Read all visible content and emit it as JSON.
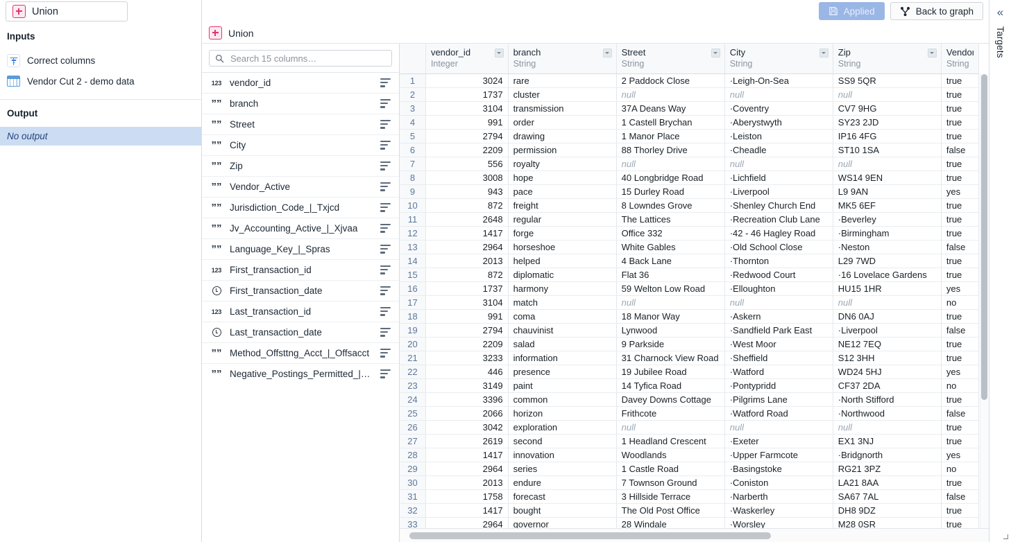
{
  "node": {
    "title": "Union",
    "icon": "union-icon"
  },
  "sidebar": {
    "inputs_title": "Inputs",
    "inputs": [
      {
        "label": "Correct columns",
        "icon": "filter-step-icon"
      },
      {
        "label": "Vendor Cut 2 - demo data",
        "icon": "table-dataset-icon"
      }
    ],
    "output_title": "Output",
    "output_value": "No output"
  },
  "toolbar": {
    "applied_label": "Applied",
    "applied_icon": "save-icon",
    "back_label": "Back to graph",
    "back_icon": "graph-icon"
  },
  "rail": {
    "collapse_icon": "chevron-double-left-icon",
    "label": "Targets"
  },
  "panel": {
    "title": "Union"
  },
  "search": {
    "placeholder": "Search 15 columns…",
    "value": "",
    "icon": "search-icon"
  },
  "columns_panel": {
    "items": [
      {
        "name": "vendor_id",
        "type": "number"
      },
      {
        "name": "branch",
        "type": "string"
      },
      {
        "name": "Street",
        "type": "string"
      },
      {
        "name": "City",
        "type": "string"
      },
      {
        "name": "Zip",
        "type": "string"
      },
      {
        "name": "Vendor_Active",
        "type": "string"
      },
      {
        "name": "Jurisdiction_Code_|_Txjcd",
        "type": "string"
      },
      {
        "name": "Jv_Accounting_Active_|_Xjvaa",
        "type": "string"
      },
      {
        "name": "Language_Key_|_Spras",
        "type": "string"
      },
      {
        "name": "First_transaction_id",
        "type": "number"
      },
      {
        "name": "First_transaction_date",
        "type": "date"
      },
      {
        "name": "Last_transaction_id",
        "type": "number"
      },
      {
        "name": "Last_transaction_date",
        "type": "date"
      },
      {
        "name": "Method_Offsttng_Acct_|_Offsacct",
        "type": "string"
      },
      {
        "name": "Negative_Postings_Permitted_|…",
        "type": "string"
      }
    ]
  },
  "table": {
    "headers": [
      {
        "name": "vendor_id",
        "type": "Integer",
        "caret": true
      },
      {
        "name": "branch",
        "type": "String",
        "caret": true
      },
      {
        "name": "Street",
        "type": "String",
        "caret": true
      },
      {
        "name": "City",
        "type": "String",
        "caret": true
      },
      {
        "name": "Zip",
        "type": "String",
        "caret": true
      },
      {
        "name": "Vendor_",
        "type": "String",
        "caret": false
      }
    ],
    "rows": [
      {
        "n": "1",
        "vendor_id": "3024",
        "branch": "rare",
        "street": "2 Paddock Close",
        "city": "·Leigh-On-Sea",
        "zip": "SS9 5QR",
        "active": "true"
      },
      {
        "n": "2",
        "vendor_id": "1737",
        "branch": "cluster",
        "street": "null",
        "city": "null",
        "zip": "null",
        "active": "true"
      },
      {
        "n": "3",
        "vendor_id": "3104",
        "branch": "transmission",
        "street": "37A Deans Way",
        "city": "·Coventry",
        "zip": "CV7 9HG",
        "active": "true"
      },
      {
        "n": "4",
        "vendor_id": "991",
        "branch": "order",
        "street": "1 Castell Brychan",
        "city": "·Aberystwyth",
        "zip": "SY23 2JD",
        "active": "true"
      },
      {
        "n": "5",
        "vendor_id": "2794",
        "branch": "drawing",
        "street": "1 Manor Place",
        "city": "·Leiston",
        "zip": "IP16 4FG",
        "active": "true"
      },
      {
        "n": "6",
        "vendor_id": "2209",
        "branch": "permission",
        "street": "88 Thorley Drive",
        "city": "·Cheadle",
        "zip": "ST10 1SA",
        "active": "false"
      },
      {
        "n": "7",
        "vendor_id": "556",
        "branch": "royalty",
        "street": "null",
        "city": "null",
        "zip": "null",
        "active": "true"
      },
      {
        "n": "8",
        "vendor_id": "3008",
        "branch": "hope",
        "street": "40 Longbridge Road",
        "city": "·Lichfield",
        "zip": "WS14 9EN",
        "active": "true"
      },
      {
        "n": "9",
        "vendor_id": "943",
        "branch": "pace",
        "street": "15 Durley Road",
        "city": "·Liverpool",
        "zip": "L9 9AN",
        "active": "yes"
      },
      {
        "n": "10",
        "vendor_id": "872",
        "branch": "freight",
        "street": "8 Lowndes Grove",
        "city": "·Shenley Church End",
        "zip": "MK5 6EF",
        "active": "true"
      },
      {
        "n": "11",
        "vendor_id": "2648",
        "branch": "regular",
        "street": "The Lattices",
        "city": "·Recreation Club Lane",
        "zip": "·Beverley",
        "active": "true"
      },
      {
        "n": "12",
        "vendor_id": "1417",
        "branch": "forge",
        "street": "Office 332",
        "city": "·42 - 46 Hagley Road",
        "zip": "·Birmingham",
        "active": "true"
      },
      {
        "n": "13",
        "vendor_id": "2964",
        "branch": "horseshoe",
        "street": "White Gables",
        "city": "·Old School Close",
        "zip": "·Neston",
        "active": "false"
      },
      {
        "n": "14",
        "vendor_id": "2013",
        "branch": "helped",
        "street": "4 Back Lane",
        "city": "·Thornton",
        "zip": "L29 7WD",
        "active": "true"
      },
      {
        "n": "15",
        "vendor_id": "872",
        "branch": "diplomatic",
        "street": "Flat 36",
        "city": "·Redwood Court",
        "zip": "·16 Lovelace Gardens",
        "active": "true"
      },
      {
        "n": "16",
        "vendor_id": "1737",
        "branch": "harmony",
        "street": "59 Welton Low Road",
        "city": "·Elloughton",
        "zip": "HU15 1HR",
        "active": "yes"
      },
      {
        "n": "17",
        "vendor_id": "3104",
        "branch": "match",
        "street": "null",
        "city": "null",
        "zip": "null",
        "active": "no"
      },
      {
        "n": "18",
        "vendor_id": "991",
        "branch": "coma",
        "street": "18 Manor Way",
        "city": "·Askern",
        "zip": "DN6 0AJ",
        "active": "true"
      },
      {
        "n": "19",
        "vendor_id": "2794",
        "branch": "chauvinist",
        "street": "Lynwood",
        "city": "·Sandfield Park East",
        "zip": "·Liverpool",
        "active": "false"
      },
      {
        "n": "20",
        "vendor_id": "2209",
        "branch": "salad",
        "street": "9 Parkside",
        "city": "·West Moor",
        "zip": "NE12 7EQ",
        "active": "true"
      },
      {
        "n": "21",
        "vendor_id": "3233",
        "branch": "information",
        "street": "31 Charnock View Road",
        "city": "·Sheffield",
        "zip": "S12 3HH",
        "active": "true"
      },
      {
        "n": "22",
        "vendor_id": "446",
        "branch": "presence",
        "street": "19 Jubilee Road",
        "city": "·Watford",
        "zip": "WD24 5HJ",
        "active": "yes"
      },
      {
        "n": "23",
        "vendor_id": "3149",
        "branch": "paint",
        "street": "14 Tyfica Road",
        "city": "·Pontypridd",
        "zip": "CF37 2DA",
        "active": "no"
      },
      {
        "n": "24",
        "vendor_id": "3396",
        "branch": "common",
        "street": "Davey Downs Cottage",
        "city": "·Pilgrims Lane",
        "zip": "·North Stifford",
        "active": "true"
      },
      {
        "n": "25",
        "vendor_id": "2066",
        "branch": "horizon",
        "street": "Frithcote",
        "city": "·Watford Road",
        "zip": "·Northwood",
        "active": "false"
      },
      {
        "n": "26",
        "vendor_id": "3042",
        "branch": "exploration",
        "street": "null",
        "city": "null",
        "zip": "null",
        "active": "true"
      },
      {
        "n": "27",
        "vendor_id": "2619",
        "branch": "second",
        "street": "1 Headland Crescent",
        "city": "·Exeter",
        "zip": "EX1 3NJ",
        "active": "true"
      },
      {
        "n": "28",
        "vendor_id": "1417",
        "branch": "innovation",
        "street": "Woodlands",
        "city": "·Upper Farmcote",
        "zip": "·Bridgnorth",
        "active": "yes"
      },
      {
        "n": "29",
        "vendor_id": "2964",
        "branch": "series",
        "street": "1 Castle Road",
        "city": "·Basingstoke",
        "zip": "RG21 3PZ",
        "active": "no"
      },
      {
        "n": "30",
        "vendor_id": "2013",
        "branch": "endure",
        "street": "7 Townson Ground",
        "city": "·Coniston",
        "zip": "LA21 8AA",
        "active": "true"
      },
      {
        "n": "31",
        "vendor_id": "1758",
        "branch": "forecast",
        "street": "3 Hillside Terrace",
        "city": "·Narberth",
        "zip": "SA67 7AL",
        "active": "false"
      },
      {
        "n": "32",
        "vendor_id": "1417",
        "branch": "bought",
        "street": "The Old Post Office",
        "city": "·Waskerley",
        "zip": "DH8 9DZ",
        "active": "true"
      },
      {
        "n": "33",
        "vendor_id": "2964",
        "branch": "governor",
        "street": "28 Windale",
        "city": "·Worsley",
        "zip": "M28 0SR",
        "active": "true"
      }
    ]
  }
}
